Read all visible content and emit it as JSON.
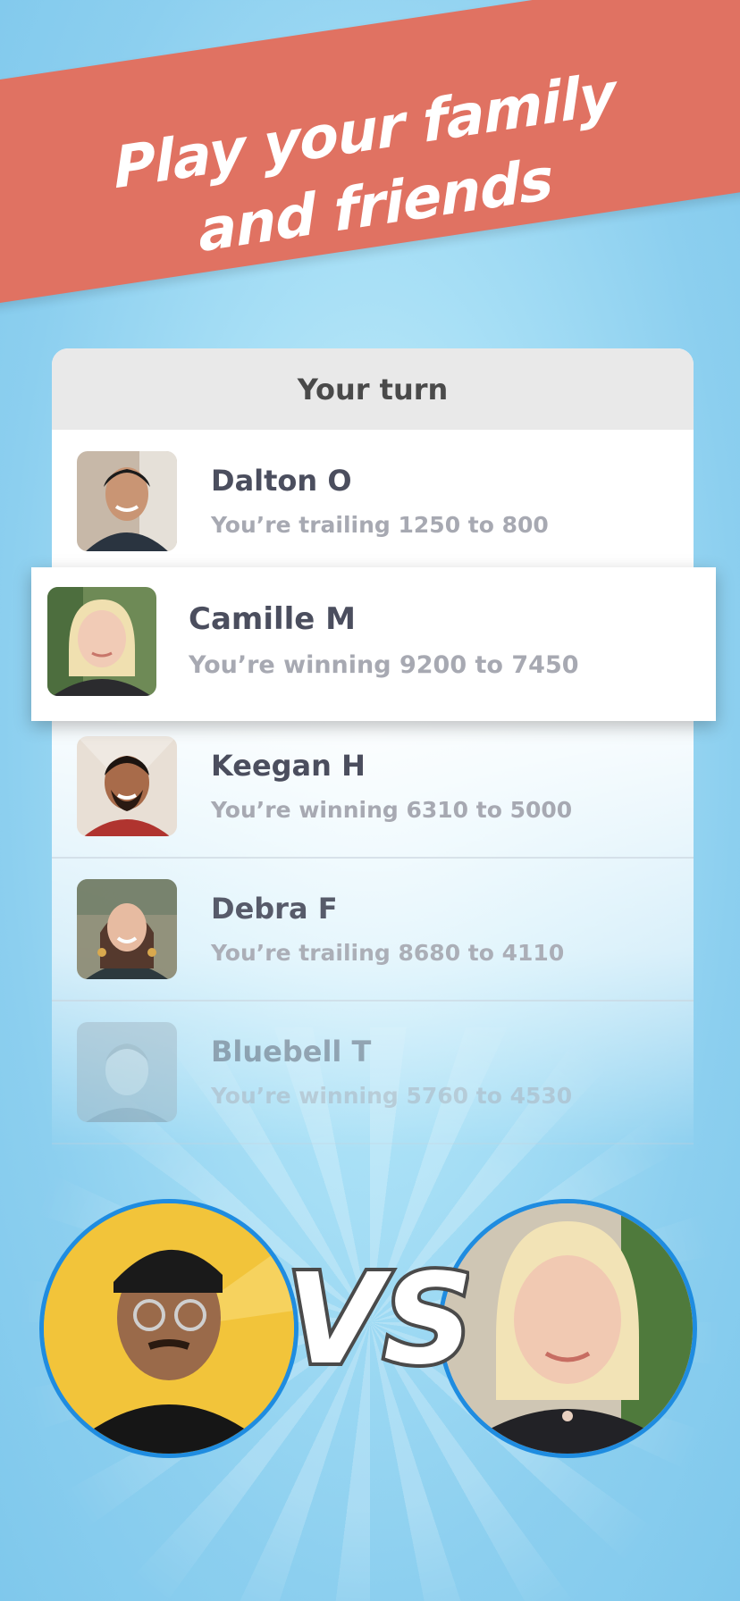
{
  "banner": {
    "line1": "Play your family",
    "line2": "and friends"
  },
  "list": {
    "header": "Your turn",
    "items": [
      {
        "name": "Dalton O",
        "status": "You’re trailing 1250 to 800"
      },
      {
        "name": "Camille M",
        "status": "You’re winning 9200 to 7450"
      },
      {
        "name": "Keegan H",
        "status": "You’re winning 6310 to 5000"
      },
      {
        "name": "Debra F",
        "status": "You’re trailing 8680 to 4110"
      },
      {
        "name": "Bluebell T",
        "status": "You’re winning 5760 to 4530"
      }
    ]
  },
  "versus": {
    "label": "VS"
  },
  "colors": {
    "banner": "#e07262",
    "background": "#8ccfef",
    "avatar_ring": "#1f8ce0",
    "name_text": "#4b4e5e",
    "status_text": "#a7a9b2"
  }
}
